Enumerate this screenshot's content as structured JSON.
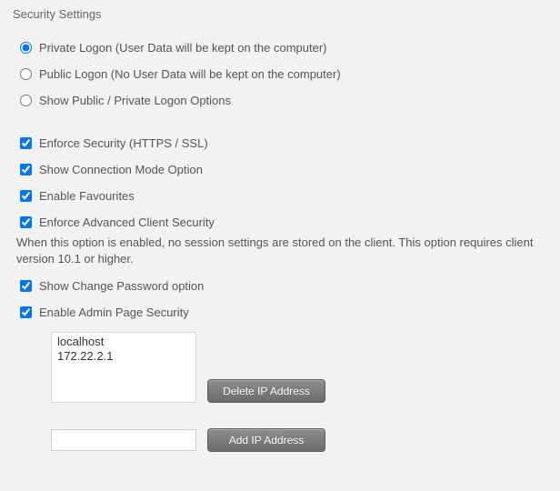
{
  "title": "Security Settings",
  "logon": {
    "private": "Private Logon (User Data will be kept on the computer)",
    "public": "Public Logon (No User Data will be kept on the computer)",
    "show": "Show Public / Private Logon Options"
  },
  "opts": {
    "enforceSecurity": "Enforce Security (HTTPS / SSL)",
    "showConnectionMode": "Show Connection Mode Option",
    "enableFavourites": "Enable Favourites",
    "enforceAdvanced": "Enforce Advanced Client Security",
    "enforceAdvancedHelp": "When this option is enabled, no session settings are stored on the client. This option requires client version 10.1 or higher.",
    "showChangePassword": "Show Change Password option",
    "enableAdminSecurity": "Enable Admin Page Security"
  },
  "ip": {
    "entries": [
      "localhost",
      "172.22.2.1"
    ],
    "deleteBtn": "Delete IP Address",
    "addBtn": "Add IP Address",
    "input": ""
  }
}
